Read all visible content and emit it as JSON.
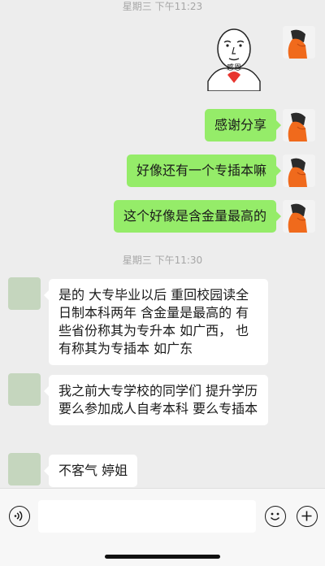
{
  "chat": {
    "timestamp_1": "星期三 下午11:23",
    "timestamp_2": "星期三 下午11:30",
    "sticker_text": "感恩",
    "messages_me": [
      "感谢分享",
      "好像还有一个专插本嘛",
      "这个好像是含金量最高的"
    ],
    "messages_other": [
      "是的 大专毕业以后 重回校园读全日制本科两年 含金量是最高的  有些省份称其为专升本  如广西，  也有称其为专插本  如广东",
      "我之前大专学校的同学们  提升学历  要么参加成人自考本科  要么专插本",
      "不客气  婷姐"
    ]
  },
  "input_bar": {
    "voice_icon": "voice-icon",
    "emoji_icon": "emoji-icon",
    "plus_icon": "plus-icon"
  },
  "colors": {
    "background": "#ededed",
    "bubble_me": "#95ec69",
    "bubble_other": "#ffffff",
    "avatar_other": "#c5d6be",
    "avatar_me_accent": "#f06a1c"
  }
}
